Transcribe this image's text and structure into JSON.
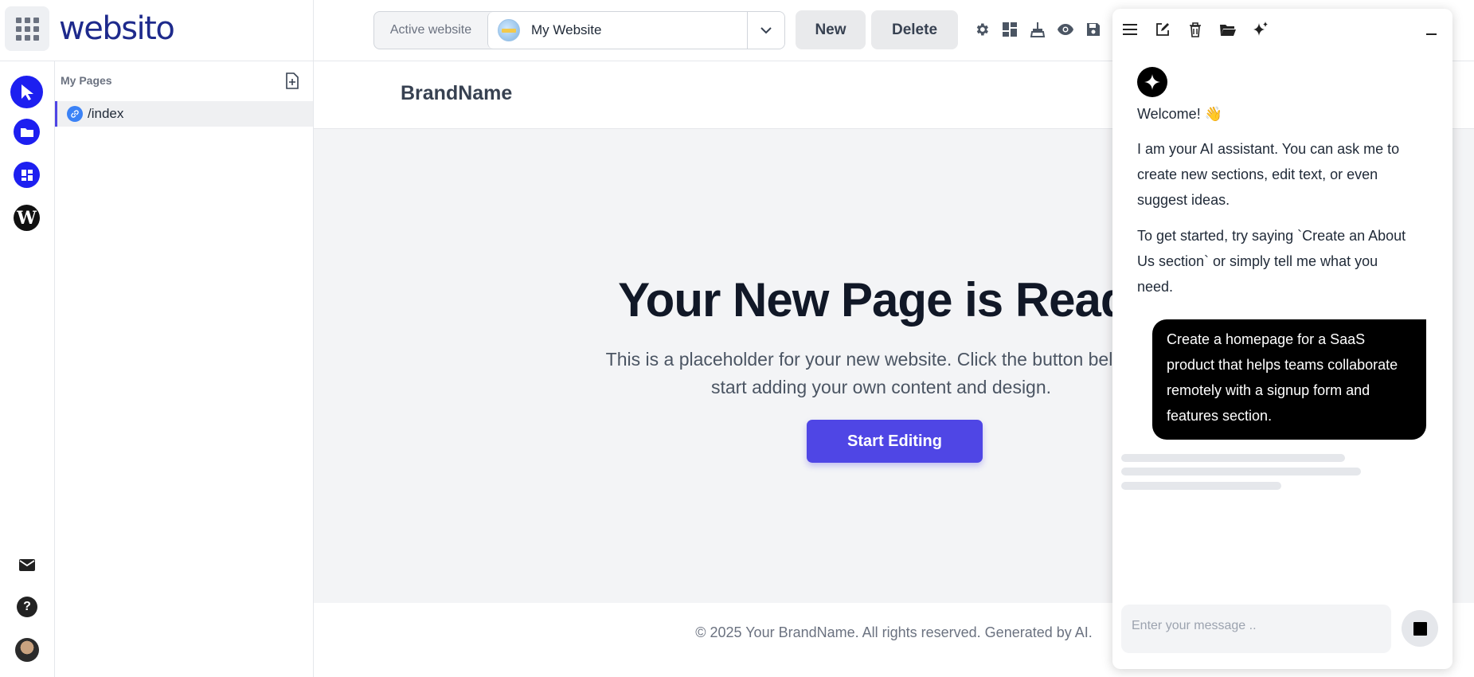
{
  "app": {
    "logo": "websito"
  },
  "header": {
    "active_website_label": "Active website",
    "active_website_value": "My Website",
    "new_label": "New",
    "delete_label": "Delete",
    "icons": [
      "gear-icon",
      "layout-icon",
      "broom-icon",
      "eye-icon",
      "save-icon"
    ]
  },
  "rail": {
    "top": [
      "pointer-icon",
      "folder-icon",
      "dashboard-icon",
      "wordpress-icon"
    ],
    "bottom": [
      "mail-icon",
      "help-icon",
      "avatar"
    ]
  },
  "pages": {
    "title": "My Pages",
    "items": [
      {
        "label": "/index"
      }
    ]
  },
  "preview": {
    "brand": "BrandName",
    "headline": "Your New Page is Ready!",
    "subtext": "This is a placeholder for your new website. Click the button below to start adding your own content and design.",
    "cta": "Start Editing",
    "footer": "© 2025 Your BrandName. All rights reserved. Generated by AI."
  },
  "chat": {
    "toolbar": [
      "menu-icon",
      "edit-icon",
      "trash-icon",
      "folder-open-icon",
      "sparkle-icon"
    ],
    "welcome": "Welcome! 👋",
    "intro": "I am your AI assistant. You can ask me to create new sections, edit text, or even suggest ideas.",
    "hint": "To get started, try saying `Create an About Us section` or simply tell me what you need.",
    "user_message": "Create a homepage for a SaaS product that helps teams collaborate remotely with a signup form and features section.",
    "input_placeholder": "Enter your message .."
  },
  "colors": {
    "accent": "#4f46e5",
    "rail_active": "#1d1ff0",
    "logo": "#1e2a8c"
  }
}
